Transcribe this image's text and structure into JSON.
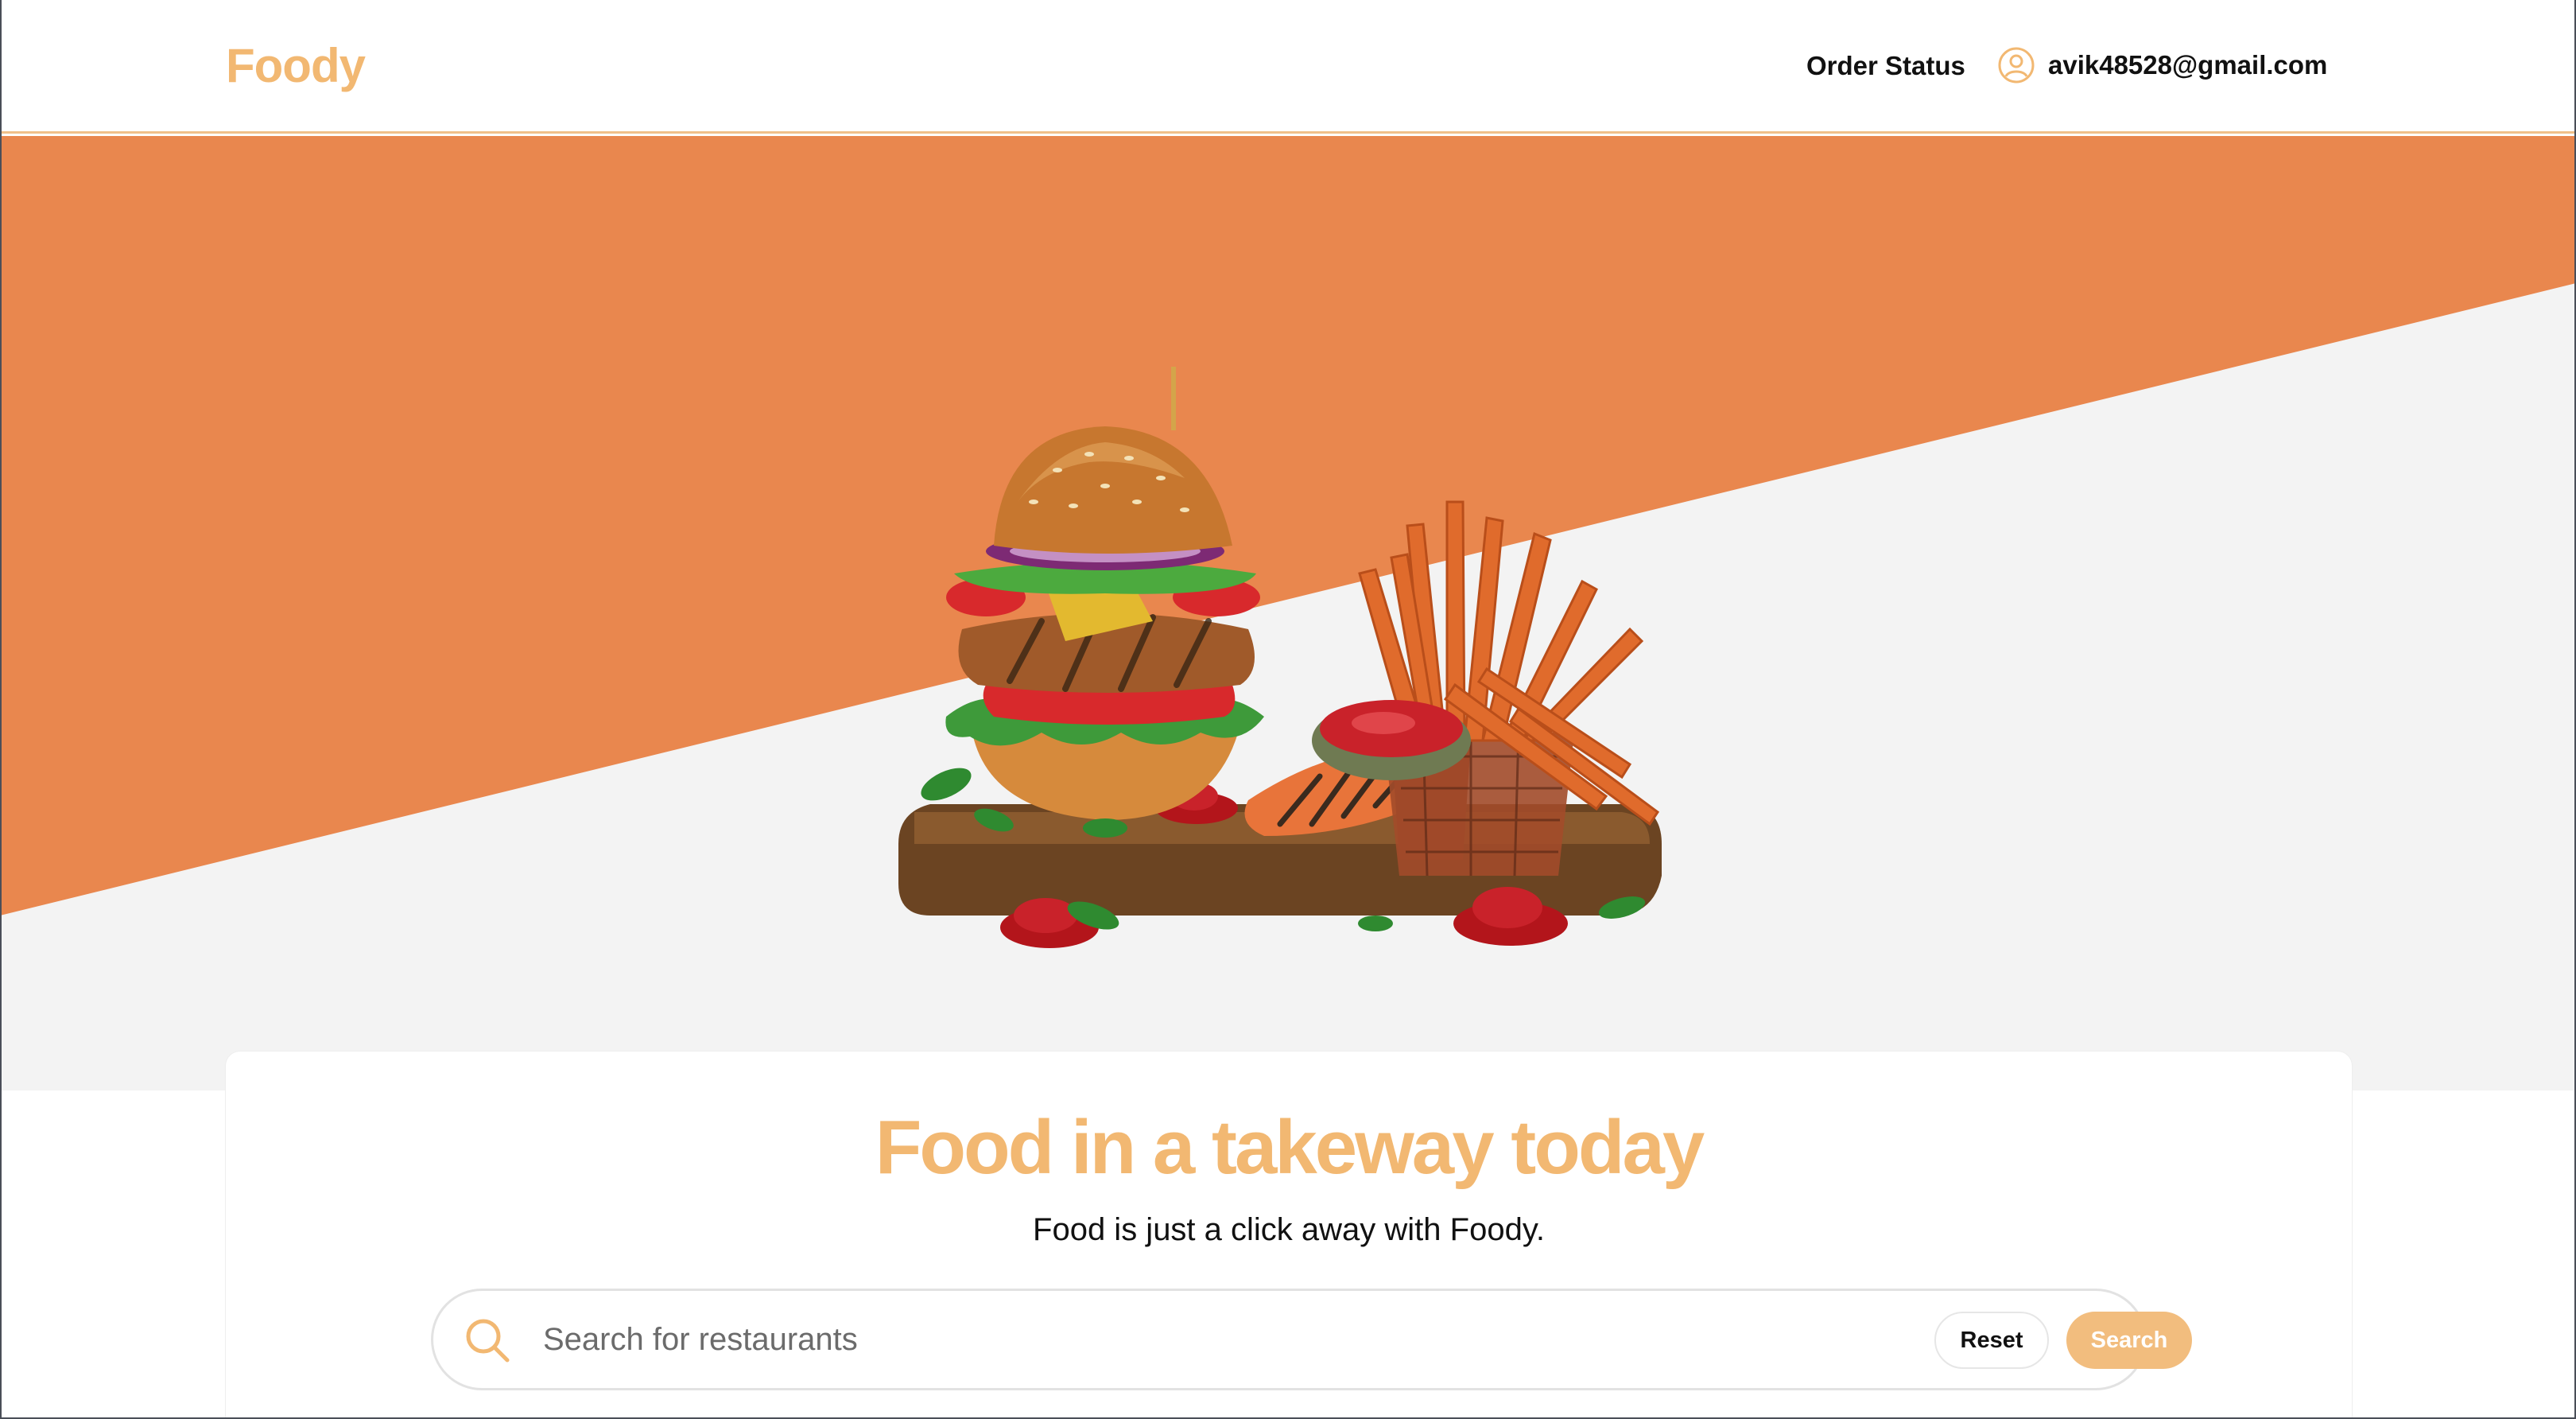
{
  "header": {
    "logo": "Foody",
    "order_status": "Order Status",
    "user_email": "avik48528@gmail.com",
    "user_icon": "user-circle-icon"
  },
  "hero": {
    "image_subject": "burger-and-sweet-potato-fries-illustration",
    "accent_color": "#e9874e",
    "background_color": "#f3f3f3"
  },
  "card": {
    "title": "Food in a takeway today",
    "subtitle": "Food is just a click away with Foody.",
    "search": {
      "placeholder": "Search for restaurants",
      "value": "",
      "icon": "search-icon",
      "reset_label": "Reset",
      "search_label": "Search"
    }
  },
  "colors": {
    "brand": "#f2b872",
    "search_button": "#f2bd7e",
    "text": "#111111"
  }
}
